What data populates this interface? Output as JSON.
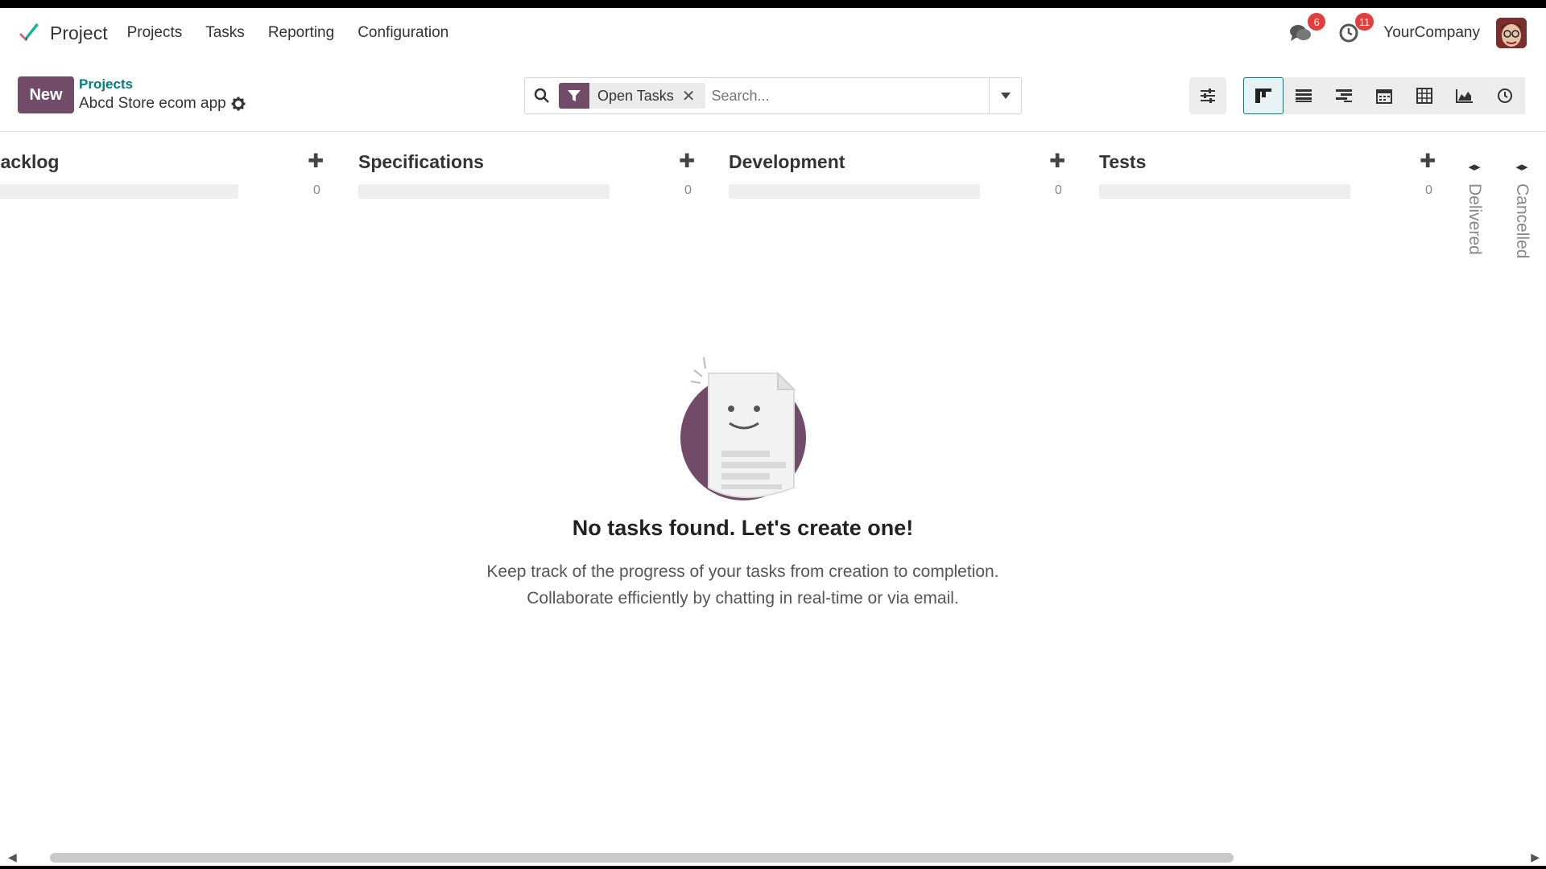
{
  "app": {
    "name": "Project",
    "menu": [
      "Projects",
      "Tasks",
      "Reporting",
      "Configuration"
    ],
    "company": "YourCompany",
    "badges": {
      "messages": "6",
      "activities": "11"
    }
  },
  "control": {
    "new_label": "New",
    "breadcrumb_parent": "Projects",
    "breadcrumb_current": "Abcd Store ecom app",
    "facet_label": "Open Tasks",
    "facet_remove": "✕",
    "search_placeholder": "Search..."
  },
  "columns": [
    {
      "title": "Backlog",
      "count": "0"
    },
    {
      "title": "Specifications",
      "count": "0"
    },
    {
      "title": "Development",
      "count": "0"
    },
    {
      "title": "Tests",
      "count": "0"
    }
  ],
  "folded_columns": [
    "Delivered",
    "Cancelled"
  ],
  "empty": {
    "title": "No tasks found. Let's create one!",
    "line1": "Keep track of the progress of your tasks from creation to completion.",
    "line2": "Collaborate efficiently by chatting in real-time or via email."
  },
  "colors": {
    "brand": "#714b67",
    "link": "#017e84"
  }
}
